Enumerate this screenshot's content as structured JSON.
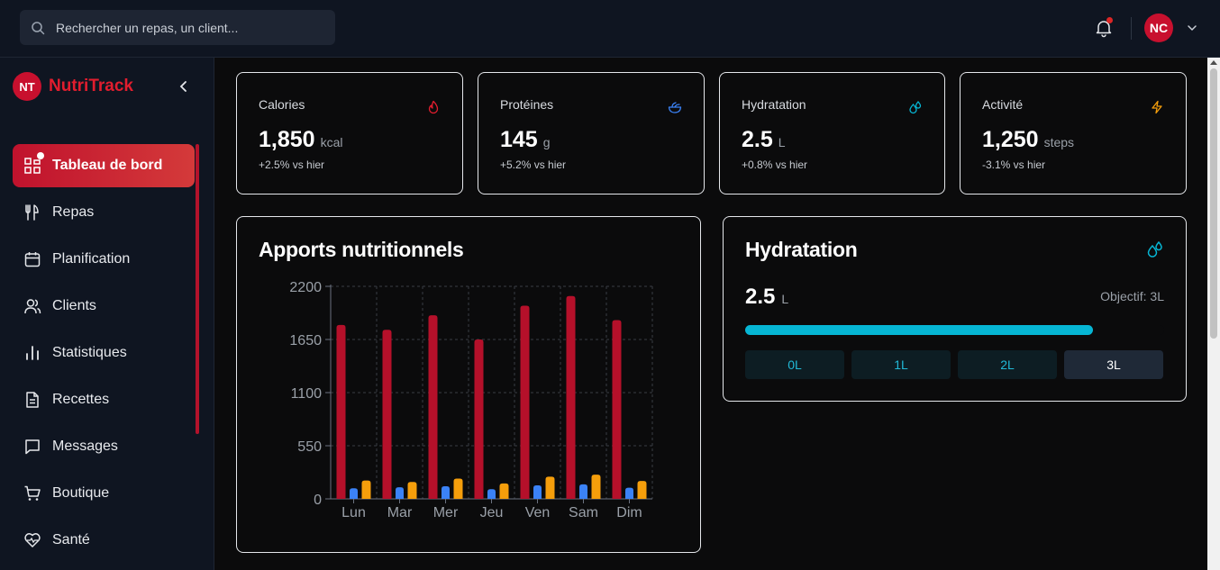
{
  "search": {
    "placeholder": "Rechercher un repas, un client..."
  },
  "user": {
    "initials": "NC"
  },
  "brand": {
    "logo": "NT",
    "name": "NutriTrack"
  },
  "sidebar": {
    "items": [
      {
        "label": "Tableau de bord",
        "icon": "dashboard-icon",
        "active": true
      },
      {
        "label": "Repas",
        "icon": "utensils-icon"
      },
      {
        "label": "Planification",
        "icon": "calendar-icon"
      },
      {
        "label": "Clients",
        "icon": "users-icon"
      },
      {
        "label": "Statistiques",
        "icon": "bar-chart-icon"
      },
      {
        "label": "Recettes",
        "icon": "document-icon"
      },
      {
        "label": "Messages",
        "icon": "message-icon"
      },
      {
        "label": "Boutique",
        "icon": "cart-icon"
      },
      {
        "label": "Santé",
        "icon": "heart-pulse-icon"
      }
    ]
  },
  "stats": [
    {
      "title": "Calories",
      "value": "1,850",
      "unit": "kcal",
      "change": "+2.5% vs hier",
      "icon": "flame-icon",
      "color": "#e11d2e"
    },
    {
      "title": "Protéines",
      "value": "145",
      "unit": "g",
      "change": "+5.2% vs hier",
      "icon": "salad-bowl-icon",
      "color": "#3b82f6"
    },
    {
      "title": "Hydratation",
      "value": "2.5",
      "unit": "L",
      "change": "+0.8% vs hier",
      "icon": "droplets-icon",
      "color": "#06b6d4"
    },
    {
      "title": "Activité",
      "value": "1,250",
      "unit": "steps",
      "change": "-3.1% vs hier",
      "icon": "zap-icon",
      "color": "#f59e0b"
    }
  ],
  "nutrition_panel": {
    "title": "Apports nutritionnels"
  },
  "hydration_panel": {
    "title": "Hydratation",
    "value": "2.5",
    "unit": "L",
    "goal": "Objectif: 3L",
    "progress": 0.83,
    "buttons": [
      "0L",
      "1L",
      "2L",
      "3L"
    ],
    "selected": "3L"
  },
  "colors": {
    "accent": "#c8102e",
    "hydration": "#06b6d4"
  },
  "chart_data": {
    "type": "bar",
    "categories": [
      "Lun",
      "Mar",
      "Mer",
      "Jeu",
      "Ven",
      "Sam",
      "Dim"
    ],
    "series": [
      {
        "values": [
          1800,
          1750,
          1900,
          1650,
          2000,
          2100,
          1850
        ],
        "color": "#b5102a"
      },
      {
        "values": [
          110,
          120,
          130,
          100,
          140,
          150,
          115
        ],
        "color": "#3b82f6"
      },
      {
        "values": [
          190,
          175,
          210,
          160,
          230,
          250,
          185
        ],
        "color": "#f59e0b"
      }
    ],
    "y_ticks": [
      0,
      550,
      1100,
      1650,
      2200
    ],
    "ylim": [
      0,
      2200
    ],
    "grid": true
  }
}
